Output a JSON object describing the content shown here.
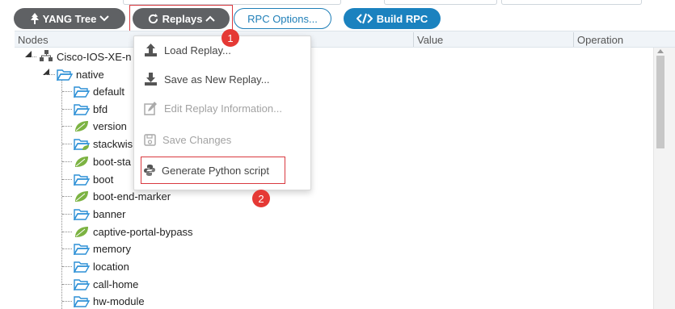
{
  "toolbar": {
    "yang_tree_label": "YANG Tree",
    "replays_label": "Replays",
    "rpc_options_label": "RPC Options...",
    "build_rpc_label": "Build RPC"
  },
  "markers": {
    "first": "1",
    "second": "2"
  },
  "table": {
    "columns": [
      "Nodes",
      "Value",
      "Operation"
    ]
  },
  "tree": {
    "root": "Cisco-IOS-XE-n",
    "container": "native",
    "children": [
      {
        "label": "default",
        "icon": "folder-icon"
      },
      {
        "label": "bfd",
        "icon": "folder-icon"
      },
      {
        "label": "version",
        "icon": "leaf-icon"
      },
      {
        "label": "stackwis",
        "icon": "folder-leaf-icon"
      },
      {
        "label": "boot-sta",
        "icon": "leaf-icon"
      },
      {
        "label": "boot",
        "icon": "folder-icon"
      },
      {
        "label": "boot-end-marker",
        "icon": "leaf-icon"
      },
      {
        "label": "banner",
        "icon": "folder-icon"
      },
      {
        "label": "captive-portal-bypass",
        "icon": "leaf-icon"
      },
      {
        "label": "memory",
        "icon": "folder-icon"
      },
      {
        "label": "location",
        "icon": "folder-icon"
      },
      {
        "label": "call-home",
        "icon": "folder-icon"
      },
      {
        "label": "hw-module",
        "icon": "folder-icon"
      }
    ]
  },
  "menu": {
    "items": [
      {
        "label": "Load Replay...",
        "icon": "upload-icon",
        "disabled": false
      },
      {
        "label": "Save as New Replay...",
        "icon": "download-icon",
        "disabled": false
      },
      {
        "label": "Edit Replay Information...",
        "icon": "edit-icon",
        "disabled": true
      },
      {
        "label": "Save Changes",
        "icon": "save-icon",
        "disabled": true
      },
      {
        "label": "Generate Python script",
        "icon": "python-icon",
        "disabled": false
      }
    ]
  },
  "colors": {
    "accent": "#1b82bf",
    "dark_button": "#5f6164",
    "highlight": "#d9393f",
    "leaf": "#7cb342",
    "folder": "#2b8fd6"
  }
}
